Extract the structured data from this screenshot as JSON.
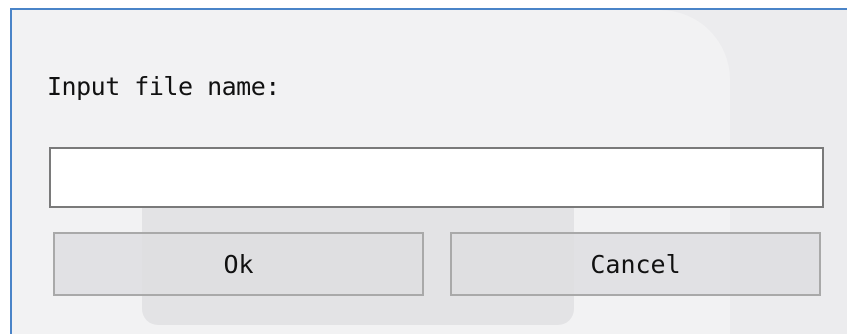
{
  "dialog": {
    "prompt_label": "Input file name:",
    "filename_value": "",
    "ok_label": "Ok",
    "cancel_label": "Cancel"
  },
  "colors": {
    "window_border": "#4a84c8",
    "dialog_background": "#ececee",
    "input_background": "#ffffff"
  }
}
